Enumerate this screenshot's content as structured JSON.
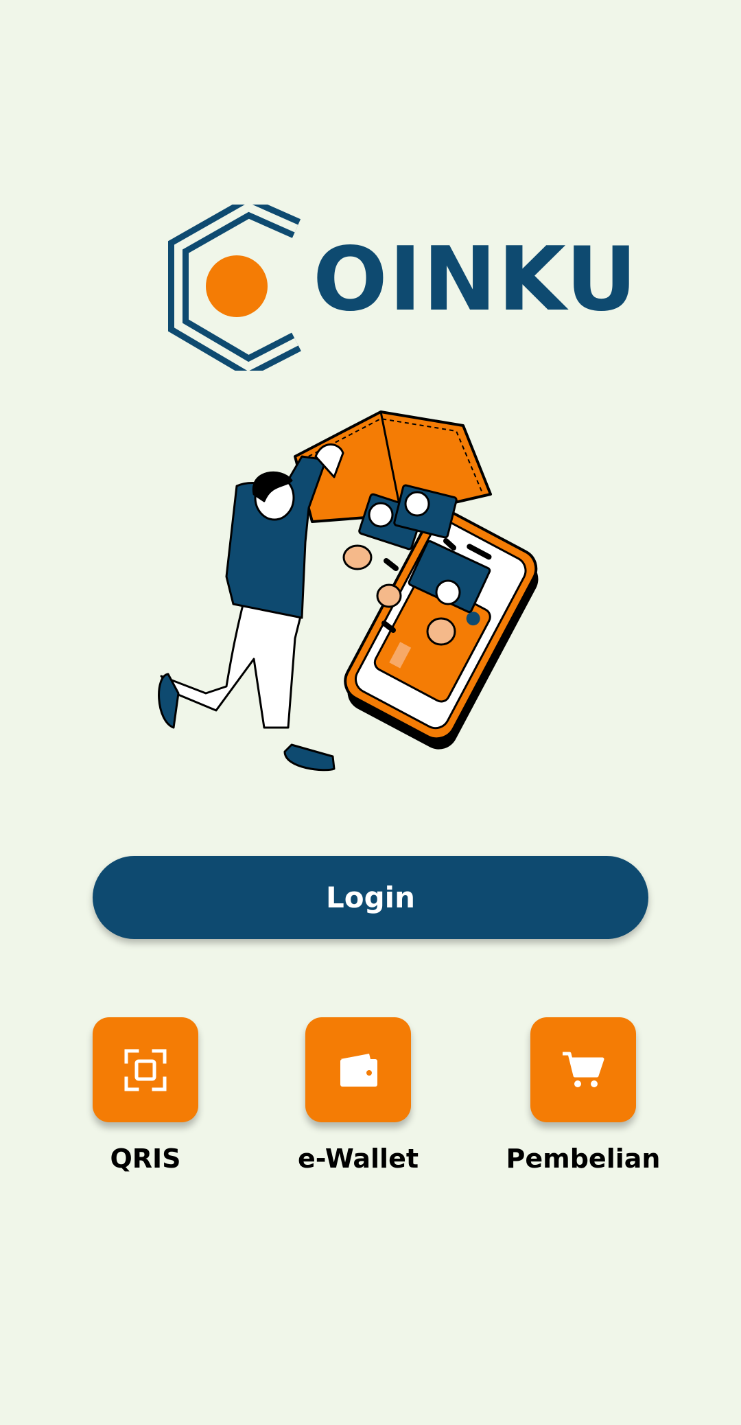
{
  "app": {
    "logo_text": "OINKU",
    "colors": {
      "brand_navy": "#0e4a70",
      "brand_orange": "#f47c05",
      "background": "#f0f6e9"
    }
  },
  "hero": {
    "illustration": "person-shaking-wallet-into-phone-illustration"
  },
  "auth": {
    "login_label": "Login"
  },
  "shortcuts": [
    {
      "label": "QRIS",
      "icon": "qr-scan-icon"
    },
    {
      "label": "e-Wallet",
      "icon": "wallet-icon"
    },
    {
      "label": "Pembelian",
      "icon": "shopping-cart-icon"
    }
  ]
}
